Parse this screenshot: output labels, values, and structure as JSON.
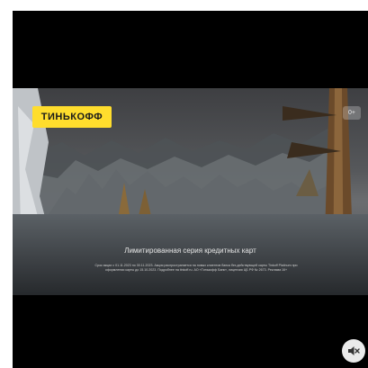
{
  "ad": {
    "brand_logo": "ТИНЬКОФФ",
    "age_rating": "0+",
    "headline": "Лимитированная серия кредитных карт",
    "legal_text": "Срок акции с 01.11.2023 по 30.11.2023. Акция распространяется на новых клиентов банка без действующей карты Tinkoff Platinum при оформлении карты до 15.10.2023. Подробнее на tinkoff.ru. АО «Тинькофф Банк», лицензия ЦБ РФ № 2673. Реклама 16+"
  },
  "controls": {
    "mute_icon": "speaker-muted-icon"
  },
  "colors": {
    "brand_yellow": "#ffdd2d",
    "player_bg": "#000000"
  }
}
